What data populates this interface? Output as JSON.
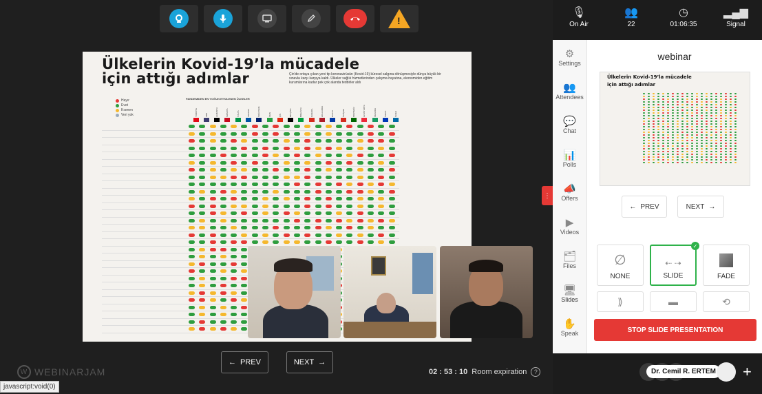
{
  "top_toolbar": {
    "buttons": [
      "webcam-icon",
      "mic-icon",
      "screen-share-icon",
      "pencil-icon",
      "hangup-icon",
      "warning-icon"
    ],
    "warning_glyph": "!"
  },
  "slide": {
    "title_line1": "Ülkelerin Kovid-19’la mücadele",
    "title_line2": "için attığı adımlar",
    "intro": "Çin'de ortaya çıkan yeni tip koronavirüsün (Kovid-19) küresel salgına dönüşmesiyle dünya büyük bir sınavla karşı karşıya kaldı. Ülkeler sağlık hizmetlerinden çalışma hayatına, ekonomiden eğitim kurumlarına kadar pek çok alanda tedbirler aldı",
    "legend": [
      {
        "label": "Hayır",
        "color": "#e53935"
      },
      {
        "label": "Evet",
        "color": "#2e9d3e"
      },
      {
        "label": "Kısmen",
        "color": "#f5b82e"
      },
      {
        "label": "Veri yok",
        "color": "#9ab"
      }
    ],
    "table_header": "PANDEMİDEN EN YOĞUN ETKİLENEN ÜLKELER",
    "countries": [
      "TÜRKİYE",
      "ABD",
      "ALMANYA",
      "İSPANYA",
      "İTALYA",
      "FRANSA",
      "İNGİLTERE",
      "İRAN",
      "ÇİN",
      "BELÇİKA",
      "BREZİLYA",
      "KANADA",
      "HOLLANDA",
      "RUSYA",
      "İSVİÇRE",
      "PORTEKİZ",
      "AVUSTURYA",
      "İRLANDA",
      "İSRAİL",
      "İSVEÇ"
    ]
  },
  "videos": [
    "participant-video-1",
    "participant-video-2",
    "participant-video-3"
  ],
  "nav": {
    "prev_label": "PREV",
    "next_label": "NEXT"
  },
  "timer": {
    "value": "02 : 53 : 10",
    "label": "Room expiration",
    "help": "?"
  },
  "logo": {
    "mark": "W",
    "text": "WEBINARJAM"
  },
  "status_bar": "javascript:void(0)",
  "right_status": [
    {
      "icon": "podcast-icon",
      "label": "On Air"
    },
    {
      "icon": "attendees-icon",
      "label": "22"
    },
    {
      "icon": "clock-icon",
      "label": "01:06:35"
    },
    {
      "icon": "signal-icon",
      "label": "Signal"
    }
  ],
  "side_menu": [
    "Settings",
    "Attendees",
    "Chat",
    "Polls",
    "Offers",
    "Videos",
    "Files",
    "Slides",
    "Speak"
  ],
  "panel": {
    "title": "webinar",
    "prev_label": "PREV",
    "next_label": "NEXT",
    "transitions": [
      "NONE",
      "SLIDE",
      "FADE"
    ],
    "stop_label": "STOP SLIDE PRESENTATION"
  },
  "user": {
    "name": "Dr. Cemil R. ERTEM",
    "plus": "+"
  }
}
